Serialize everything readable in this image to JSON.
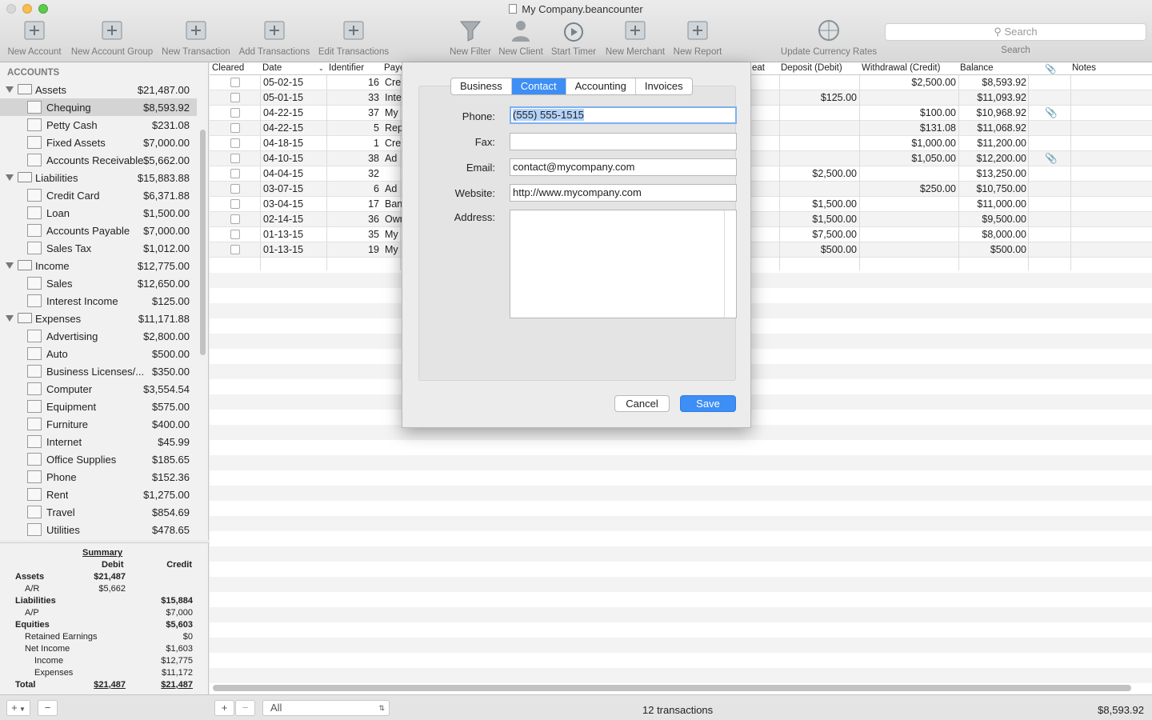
{
  "window": {
    "title": "My Company.beancounter"
  },
  "toolbar": {
    "items": [
      {
        "label": "New Account",
        "icon": "new-account-icon"
      },
      {
        "label": "New Account Group",
        "icon": "new-account-group-icon"
      },
      {
        "label": "New Transaction",
        "icon": "new-transaction-icon"
      },
      {
        "label": "Add Transactions",
        "icon": "add-transactions-icon"
      },
      {
        "label": "Edit Transactions",
        "icon": "edit-transactions-icon"
      },
      {
        "label": "New Filter",
        "icon": "filter-icon"
      },
      {
        "label": "New Client",
        "icon": "client-icon"
      },
      {
        "label": "Start Timer",
        "icon": "timer-icon"
      },
      {
        "label": "New Merchant",
        "icon": "merchant-icon"
      },
      {
        "label": "New Report",
        "icon": "report-icon"
      },
      {
        "label": "Update Currency Rates",
        "icon": "currency-globe-icon"
      }
    ],
    "search_placeholder": "Search",
    "search_label": "Search"
  },
  "sidebar": {
    "header": "ACCOUNTS",
    "groups": [
      {
        "name": "Assets",
        "amount": "$21,487.00",
        "accounts": [
          {
            "name": "Chequing",
            "amount": "$8,593.92",
            "icon": "bank-icon",
            "selected": true
          },
          {
            "name": "Petty Cash",
            "amount": "$231.08",
            "icon": "cash-icon"
          },
          {
            "name": "Fixed Assets",
            "amount": "$7,000.00",
            "icon": "house-icon"
          },
          {
            "name": "Accounts Receivable",
            "amount": "$5,662.00",
            "icon": "receivable-icon"
          }
        ]
      },
      {
        "name": "Liabilities",
        "amount": "$15,883.88",
        "accounts": [
          {
            "name": "Credit Card",
            "amount": "$6,371.88",
            "icon": "credit-card-icon"
          },
          {
            "name": "Loan",
            "amount": "$1,500.00",
            "icon": "loan-icon"
          },
          {
            "name": "Accounts Payable",
            "amount": "$7,000.00",
            "icon": "payable-icon"
          },
          {
            "name": "Sales Tax",
            "amount": "$1,012.00",
            "icon": "scales-icon"
          }
        ]
      },
      {
        "name": "Income",
        "amount": "$12,775.00",
        "accounts": [
          {
            "name": "Sales",
            "amount": "$12,650.00",
            "icon": "income-arrow-icon"
          },
          {
            "name": "Interest Income",
            "amount": "$125.00",
            "icon": "income-arrow-icon"
          }
        ]
      },
      {
        "name": "Expenses",
        "amount": "$11,171.88",
        "accounts": [
          {
            "name": "Advertising",
            "amount": "$2,800.00",
            "icon": "expense-arrow-icon"
          },
          {
            "name": "Auto",
            "amount": "$500.00",
            "icon": "expense-arrow-icon"
          },
          {
            "name": "Business Licenses/...",
            "amount": "$350.00",
            "icon": "expense-arrow-icon"
          },
          {
            "name": "Computer",
            "amount": "$3,554.54",
            "icon": "expense-arrow-icon"
          },
          {
            "name": "Equipment",
            "amount": "$575.00",
            "icon": "expense-arrow-icon"
          },
          {
            "name": "Furniture",
            "amount": "$400.00",
            "icon": "expense-arrow-icon"
          },
          {
            "name": "Internet",
            "amount": "$45.99",
            "icon": "expense-arrow-icon"
          },
          {
            "name": "Office Supplies",
            "amount": "$185.65",
            "icon": "expense-arrow-icon"
          },
          {
            "name": "Phone",
            "amount": "$152.36",
            "icon": "expense-arrow-icon"
          },
          {
            "name": "Rent",
            "amount": "$1,275.00",
            "icon": "expense-arrow-icon"
          },
          {
            "name": "Travel",
            "amount": "$854.69",
            "icon": "expense-arrow-icon"
          },
          {
            "name": "Utilities",
            "amount": "$478.65",
            "icon": "expense-arrow-icon"
          }
        ]
      }
    ]
  },
  "summary": {
    "title": "Summary",
    "debit": "Debit",
    "credit": "Credit",
    "rows": [
      {
        "label": "Assets",
        "debit": "$21,487",
        "credit": "",
        "level": 0,
        "bold": true
      },
      {
        "label": "A/R",
        "debit": "$5,662",
        "credit": "",
        "level": 1
      },
      {
        "label": "Liabilities",
        "debit": "",
        "credit": "$15,884",
        "level": 0,
        "bold": true
      },
      {
        "label": "A/P",
        "debit": "",
        "credit": "$7,000",
        "level": 1
      },
      {
        "label": "Equities",
        "debit": "",
        "credit": "$5,603",
        "level": 0,
        "bold": true
      },
      {
        "label": "Retained Earnings",
        "debit": "",
        "credit": "$0",
        "level": 1
      },
      {
        "label": "Net Income",
        "debit": "",
        "credit": "$1,603",
        "level": 1
      },
      {
        "label": "Income",
        "debit": "",
        "credit": "$12,775",
        "level": 2
      },
      {
        "label": "Expenses",
        "debit": "",
        "credit": "$11,172",
        "level": 2
      },
      {
        "label": "Total",
        "debit": "$21,487",
        "credit": "$21,487",
        "level": 0,
        "bold": true,
        "total": true
      }
    ]
  },
  "table": {
    "columns": {
      "cleared": "Cleared",
      "date": "Date",
      "identifier": "Identifier",
      "payee": "Paye",
      "repeat": "eat",
      "deposit": "Deposit (Debit)",
      "withdrawal": "Withdrawal (Credit)",
      "balance": "Balance",
      "notes": "Notes"
    },
    "rows": [
      {
        "date": "05-02-15",
        "id": "16",
        "payee": "Cre",
        "deposit": "",
        "withdrawal": "$2,500.00",
        "balance": "$8,593.92",
        "attach": false
      },
      {
        "date": "05-01-15",
        "id": "33",
        "payee": "Inte",
        "deposit": "$125.00",
        "withdrawal": "",
        "balance": "$11,093.92",
        "attach": false
      },
      {
        "date": "04-22-15",
        "id": "37",
        "payee": "My",
        "deposit": "",
        "withdrawal": "$100.00",
        "balance": "$10,968.92",
        "attach": true
      },
      {
        "date": "04-22-15",
        "id": "5",
        "payee": "Rep",
        "deposit": "",
        "withdrawal": "$131.08",
        "balance": "$11,068.92",
        "attach": false
      },
      {
        "date": "04-18-15",
        "id": "1",
        "payee": "Cre",
        "deposit": "",
        "withdrawal": "$1,000.00",
        "balance": "$11,200.00",
        "attach": false
      },
      {
        "date": "04-10-15",
        "id": "38",
        "payee": "Ad",
        "deposit": "",
        "withdrawal": "$1,050.00",
        "balance": "$12,200.00",
        "attach": true
      },
      {
        "date": "04-04-15",
        "id": "32",
        "payee": "",
        "deposit": "$2,500.00",
        "withdrawal": "",
        "balance": "$13,250.00",
        "attach": false
      },
      {
        "date": "03-07-15",
        "id": "6",
        "payee": "Ad",
        "deposit": "",
        "withdrawal": "$250.00",
        "balance": "$10,750.00",
        "attach": false
      },
      {
        "date": "03-04-15",
        "id": "17",
        "payee": "Ban",
        "deposit": "$1,500.00",
        "withdrawal": "",
        "balance": "$11,000.00",
        "attach": false
      },
      {
        "date": "02-14-15",
        "id": "36",
        "payee": "Own",
        "deposit": "$1,500.00",
        "withdrawal": "",
        "balance": "$9,500.00",
        "attach": false
      },
      {
        "date": "01-13-15",
        "id": "35",
        "payee": "My",
        "deposit": "$7,500.00",
        "withdrawal": "",
        "balance": "$8,000.00",
        "attach": false
      },
      {
        "date": "01-13-15",
        "id": "19",
        "payee": "My",
        "deposit": "$500.00",
        "withdrawal": "",
        "balance": "$500.00",
        "attach": false
      }
    ]
  },
  "dialog": {
    "tabs": [
      {
        "label": "Business",
        "active": false
      },
      {
        "label": "Contact",
        "active": true
      },
      {
        "label": "Accounting",
        "active": false
      },
      {
        "label": "Invoices",
        "active": false
      }
    ],
    "fields": {
      "phone_label": "Phone:",
      "phone": "(555) 555-1515",
      "fax_label": "Fax:",
      "fax": "",
      "email_label": "Email:",
      "email": "contact@mycompany.com",
      "website_label": "Website:",
      "website": "http://www.mycompany.com",
      "address_label": "Address:",
      "address": ""
    },
    "cancel": "Cancel",
    "save": "Save"
  },
  "bottom": {
    "filter": "All",
    "count": "12 transactions",
    "balance": "$8,593.92",
    "add": "+",
    "remove": "−"
  },
  "colors": {
    "accent": "#3d8ef5",
    "selection": "#d4d4d4"
  }
}
